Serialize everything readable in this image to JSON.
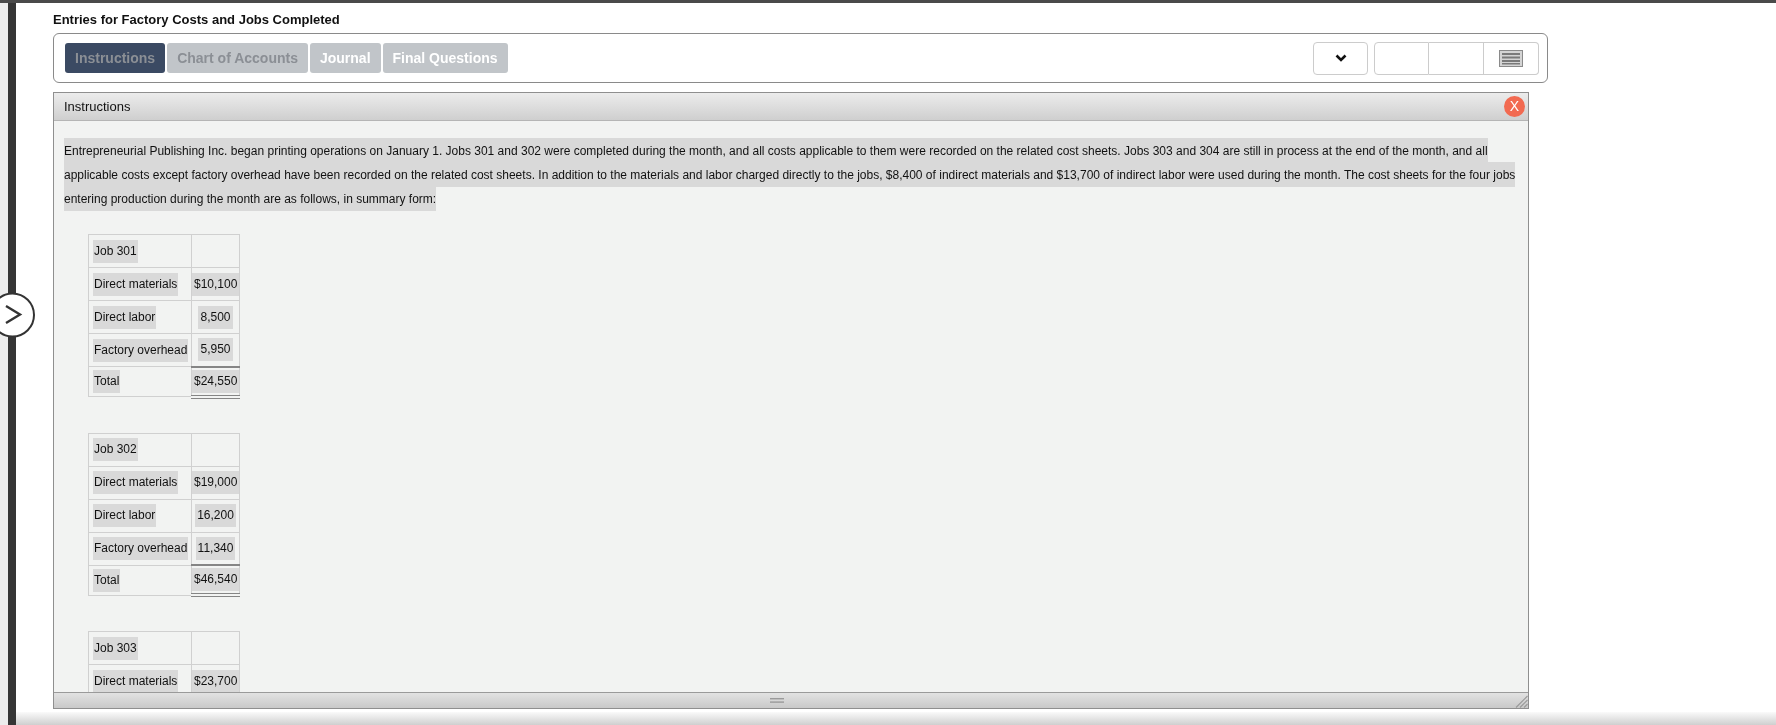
{
  "page": {
    "title": "Entries for Factory Costs and Jobs Completed"
  },
  "tabs": [
    {
      "label": "Instructions",
      "selected": true,
      "dimmed": true
    },
    {
      "label": "Chart of Accounts",
      "selected": false,
      "dimmed": true
    },
    {
      "label": "Journal",
      "selected": false,
      "dimmed": false
    },
    {
      "label": "Final Questions",
      "selected": false,
      "dimmed": false
    }
  ],
  "panel": {
    "title": "Instructions",
    "close": "X",
    "paragraph": "Entrepreneurial Publishing Inc. began printing operations on January 1. Jobs 301 and 302 were completed during the month, and all costs applicable to them were recorded on the related cost sheets. Jobs 303 and 304 are still in process at the end of the month, and all applicable costs except factory overhead have been recorded on the related cost sheets. In addition to the materials and labor charged directly to the jobs, $8,400 of indirect materials and $13,700 of indirect labor were used during the month. The cost sheets for the four jobs entering production during the month are as follows, in summary form:",
    "cost_sheets": [
      {
        "rows": [
          {
            "kind": "heading",
            "label": "Job 301"
          },
          {
            "kind": "item",
            "label": "Direct materials",
            "value": "$10,100"
          },
          {
            "kind": "item",
            "label": "Direct labor",
            "value": "8,500"
          },
          {
            "kind": "item",
            "label": "Factory overhead",
            "value": "5,950"
          },
          {
            "kind": "total",
            "label": "Total",
            "value": "$24,550"
          }
        ]
      },
      {
        "rows": [
          {
            "kind": "heading",
            "label": "Job 302"
          },
          {
            "kind": "item",
            "label": "Direct materials",
            "value": "$19,000"
          },
          {
            "kind": "item",
            "label": "Direct labor",
            "value": "16,200"
          },
          {
            "kind": "item",
            "label": "Factory overhead",
            "value": "11,340"
          },
          {
            "kind": "total",
            "label": "Total",
            "value": "$46,540"
          }
        ]
      },
      {
        "rows": [
          {
            "kind": "heading",
            "label": "Job 303"
          },
          {
            "kind": "item",
            "label": "Direct materials",
            "value": "$23,700"
          }
        ]
      }
    ]
  }
}
